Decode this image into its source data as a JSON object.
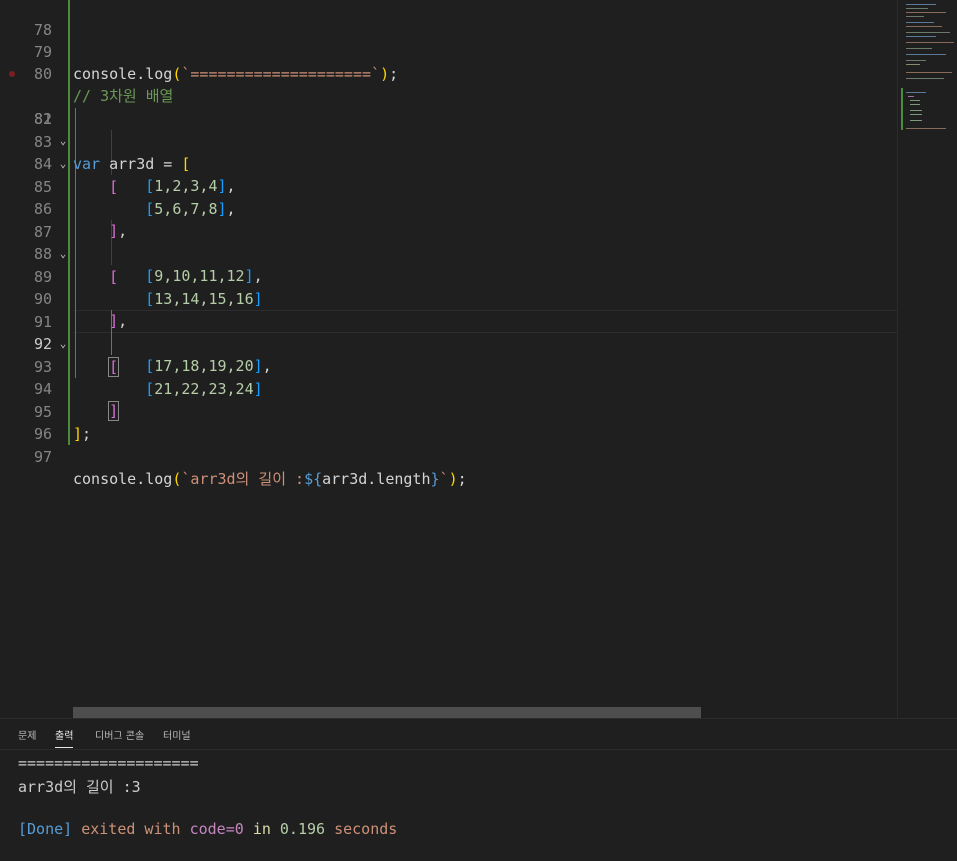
{
  "editor": {
    "lines": [
      {
        "num": "78"
      },
      {
        "num": "79",
        "t": {
          "fn": "console.log",
          "p1": "(",
          "str": "`====================`",
          "p2": ")",
          "semi": ";"
        }
      },
      {
        "num": "80",
        "comment": "// 3차원 배열"
      },
      {
        "num": "81"
      },
      {
        "num": "82",
        "t": {
          "kw": "var",
          "name": "arr3d",
          "eq": " = ",
          "open": "["
        }
      },
      {
        "num": "83",
        "t": {
          "open": "["
        }
      },
      {
        "num": "84",
        "t": {
          "open": "[",
          "vals": "1,2,3,4",
          "close": "]",
          "sep": ","
        }
      },
      {
        "num": "85",
        "t": {
          "open": "[",
          "vals": "5,6,7,8",
          "close": "]",
          "sep": ","
        }
      },
      {
        "num": "86",
        "t": {
          "close": "]",
          "sep": ","
        }
      },
      {
        "num": "87",
        "t": {
          "open": "["
        }
      },
      {
        "num": "88",
        "t": {
          "open": "[",
          "vals": "9,10,11,12",
          "close": "]",
          "sep": ","
        }
      },
      {
        "num": "89",
        "t": {
          "open": "[",
          "vals": "13,14,15,16",
          "close": "]"
        }
      },
      {
        "num": "90",
        "t": {
          "close": "]",
          "sep": ","
        }
      },
      {
        "num": "91",
        "t": {
          "open": "["
        }
      },
      {
        "num": "92",
        "t": {
          "open": "[",
          "vals": "17,18,19,20",
          "close": "]",
          "sep": ","
        }
      },
      {
        "num": "93",
        "t": {
          "open": "[",
          "vals": "21,22,23,24",
          "close": "]"
        }
      },
      {
        "num": "94",
        "t": {
          "close": "]"
        }
      },
      {
        "num": "95",
        "t": {
          "close": "]",
          "semi": ";"
        }
      },
      {
        "num": "96"
      },
      {
        "num": "97",
        "t": {
          "fn": "console.log",
          "p1": "(",
          "str1": "`arr3d의 길이 :",
          "tpl_open": "${",
          "expr": "arr3d.length",
          "tpl_close": "}",
          "str2": "`",
          "p2": ")",
          "semi": ";"
        }
      }
    ]
  },
  "panel": {
    "tabs": [
      "문제",
      "출력",
      "디버그 콘솔",
      "터미널"
    ],
    "active_tab": "출력",
    "output": {
      "line1": "====================",
      "line2": "arr3d의 길이 :3",
      "done": "[Done]",
      "exited": "exited with",
      "code_label": "code",
      "code_eq": "=0",
      "in": "in",
      "time": "0.196",
      "seconds": "seconds"
    }
  },
  "icons": {
    "fold": "chevron-down-icon",
    "breakpoint": "breakpoint-dot-icon"
  },
  "colors": {
    "bg": "#1f1f1f",
    "keyword": "#569cd6",
    "string": "#ce9178",
    "number": "#b5cea8",
    "comment": "#6a9955",
    "bracket1": "#ffd700",
    "bracket2": "#da70d6",
    "bracket3": "#179fff"
  }
}
